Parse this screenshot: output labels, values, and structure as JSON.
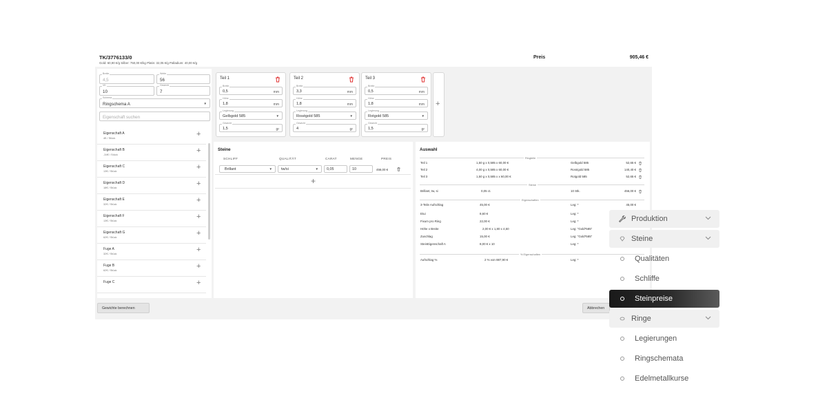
{
  "header": {
    "title": "TK/3776133/0",
    "prices_line": "Gold: 60,90 €/g   Silber: 750,00 €/kg   Platin: 32,05 €/g   Palladium: 40,00 €/g",
    "price_label": "Preis",
    "price_total": "905,46 €"
  },
  "ring": {
    "breite": {
      "label": "Breite",
      "value": "4,5"
    },
    "weite": {
      "label": "Weite",
      "value": "56"
    },
    "vk": {
      "label": "VK",
      "value": "10"
    },
    "gewicht": {
      "label": "Gewicht",
      "value": "7"
    },
    "schema": {
      "label": "Schema",
      "value": "Ringschema A"
    },
    "search_placeholder": "Eigenschaft suchen"
  },
  "properties": [
    {
      "name": "Eigenschaft A",
      "price": "4€ / Stück"
    },
    {
      "name": "Eigenschaft B",
      "price": "-34€ / Stück"
    },
    {
      "name": "Eigenschaft C",
      "price": "13€ / Stück"
    },
    {
      "name": "Eigenschaft D",
      "price": "18€ / Stück"
    },
    {
      "name": "Eigenschaft E",
      "price": "32€ / Stück"
    },
    {
      "name": "Eigenschaft F",
      "price": "13€ / Stück"
    },
    {
      "name": "Eigenschaft G",
      "price": "62€ / Stück"
    },
    {
      "name": "Fuge A",
      "price": "32€ / Stück"
    },
    {
      "name": "Fuge B",
      "price": "62€ / Stück"
    },
    {
      "name": "Fuge C",
      "price": ""
    }
  ],
  "teile": [
    {
      "name": "Teil 1",
      "breite": "0,5",
      "hoehe": "1,8",
      "legierung": "Gelbgold 585",
      "gewicht": "1,5"
    },
    {
      "name": "Teil 2",
      "breite": "3,3",
      "hoehe": "1,8",
      "legierung": "Roségold 585",
      "gewicht": "4"
    },
    {
      "name": "Teil 3",
      "breite": "0,5",
      "hoehe": "1,8",
      "legierung": "Rotgold 585",
      "gewicht": "1,5"
    }
  ],
  "teil_labels": {
    "breite": "Breite",
    "hoehe": "Höhe",
    "legierung": "Legierung",
    "gewicht": "Gewicht",
    "mm": "mm",
    "gr": "gr"
  },
  "steine": {
    "title": "Steine",
    "columns": [
      "SCHLIFF",
      "QUALITÄT",
      "CARAT",
      "MENGE",
      "PREIS"
    ],
    "row": {
      "schliff": "Brillant",
      "qualitaet": "tw/si",
      "carat": "0,05",
      "menge": "10",
      "preis": "456,00 €"
    }
  },
  "auswahl": {
    "title": "Auswahl",
    "sections": {
      "ringteile": "Ringteile",
      "steine": "Steine",
      "eigenschaften": "Eigenschaften",
      "prozent": "% Eigenschaften"
    },
    "ringteile": [
      {
        "a": "Teil 1",
        "b": "1,50 g x 0,585 x 60,00 €",
        "c": "Gelbgold 585",
        "d": "52,65 €"
      },
      {
        "a": "Teil 2",
        "b": "4,00 g x 0,585 x 60,00 €",
        "c": "Roségold 585",
        "d": "140,40 €"
      },
      {
        "a": "Teil 3",
        "b": "1,50 g x 0,585 x x 60,00 €",
        "c": "Rotgold 585",
        "d": "52,65 €"
      }
    ],
    "steine": [
      {
        "a": "Brillant, tw, si",
        "b": "0,05 ct.",
        "c": "10 Stk.",
        "d": "456,00 €"
      }
    ],
    "eigenschaften": [
      {
        "a": "3-Teile Aufschlag",
        "b": "45,00 €",
        "c": "Leg: *",
        "d": "45,00 €"
      },
      {
        "a": "Etui",
        "b": "8,60 €",
        "c": "Leg: *",
        "d": ""
      },
      {
        "a": "Fixum pro Ring",
        "b": "22,00 €",
        "c": "Leg: *",
        "d": ""
      },
      {
        "a": "Höhe x Breite",
        "b": "2,00 € x 1,80 x 4,50",
        "c": "Leg: \"Gold*585\"",
        "d": ""
      },
      {
        "a": "Zuschlag",
        "b": "15,00 €",
        "c": "Leg: \"Gold*585\"",
        "d": ""
      },
      {
        "a": "SteinEigenschaft A",
        "b": "8,00 € x 10",
        "c": "Leg: *",
        "d": ""
      }
    ],
    "prozent": [
      {
        "a": "Aufschlag %",
        "b": "2 % von 887,90 €",
        "c": "Leg: *",
        "d": ""
      }
    ]
  },
  "footer": {
    "calc_button": "Gewichte berechnen",
    "cancel_button": "Abbrechen"
  },
  "menu": [
    {
      "label": "Produktion",
      "kind": "group",
      "icon": "wrench-icon"
    },
    {
      "label": "Steine",
      "kind": "group",
      "icon": "gem-icon"
    },
    {
      "label": "Qualitäten",
      "kind": "item"
    },
    {
      "label": "Schliffe",
      "kind": "item"
    },
    {
      "label": "Steinpreise",
      "kind": "active"
    },
    {
      "label": "Ringe",
      "kind": "group",
      "icon": "ring-icon"
    },
    {
      "label": "Legierungen",
      "kind": "item"
    },
    {
      "label": "Ringschemata",
      "kind": "item"
    },
    {
      "label": "Edelmetallkurse",
      "kind": "item"
    }
  ]
}
